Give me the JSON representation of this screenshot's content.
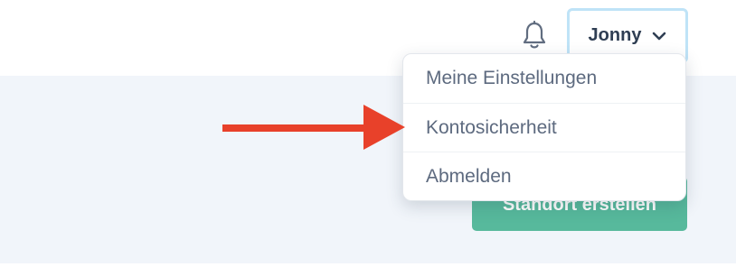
{
  "header": {
    "notifications_icon": "bell-icon",
    "user_menu": {
      "name": "Jonny",
      "icon": "chevron-down-icon"
    }
  },
  "main": {
    "create_location_label": "Standort erstellen"
  },
  "dropdown": {
    "items": [
      {
        "label": "Meine Einstellungen"
      },
      {
        "label": "Kontosicherheit"
      },
      {
        "label": "Abmelden"
      }
    ]
  },
  "annotation": {
    "arrow_color": "#e8412a",
    "arrow_target": "Kontosicherheit"
  },
  "colors": {
    "accent_green": "#57b99c",
    "focus_ring": "#bfe3f7",
    "text_dark": "#2f3e53",
    "text_muted": "#5d6a7f",
    "content_background": "#f1f5fa"
  }
}
